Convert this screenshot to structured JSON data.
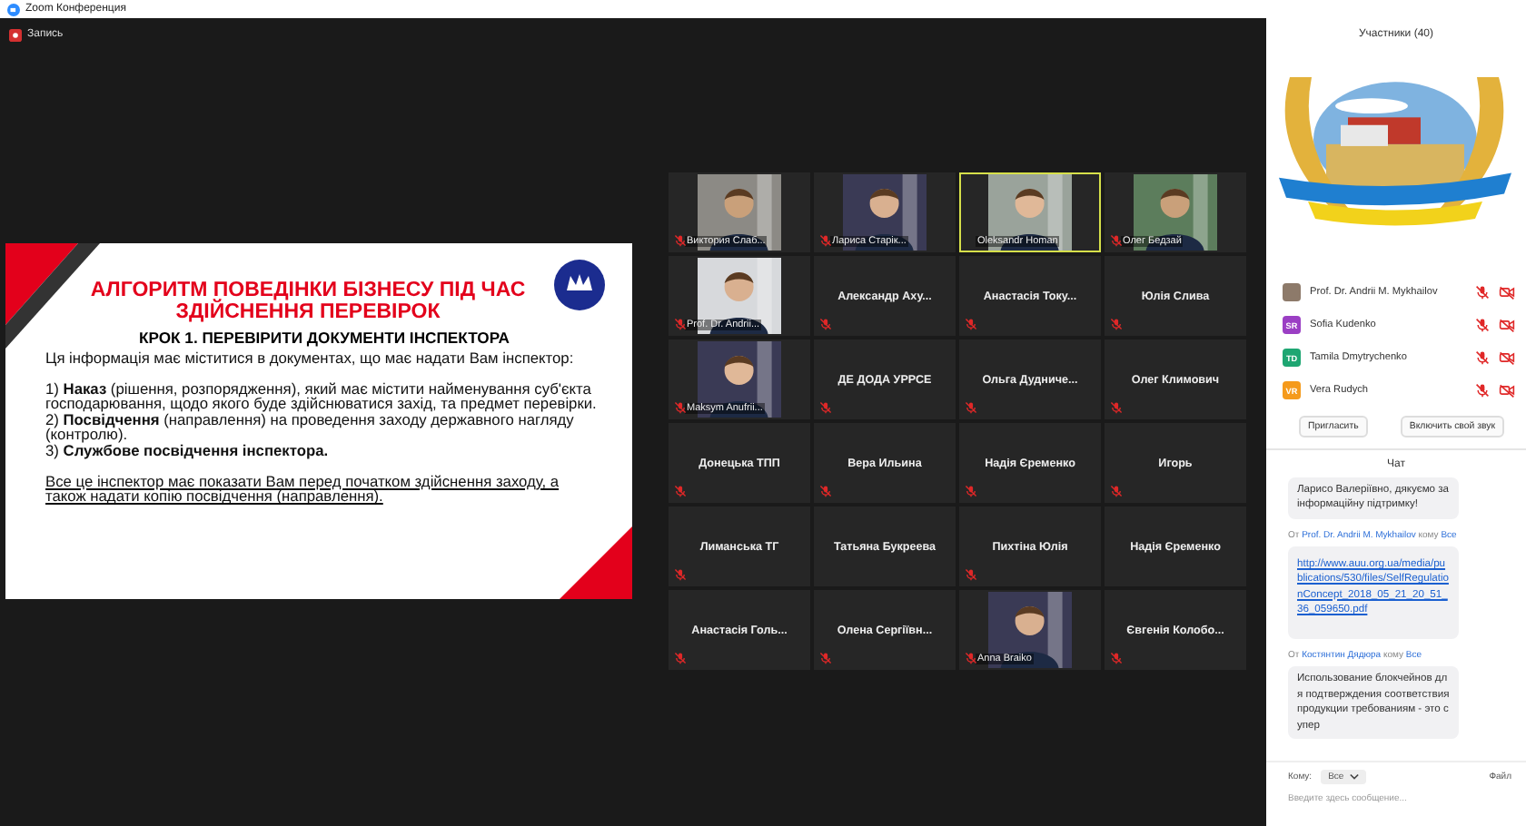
{
  "window": {
    "title": "Zoom Конференция"
  },
  "recording": {
    "label": "Запись"
  },
  "slide": {
    "title": "АЛГОРИТМ  ПОВЕДІНКИ БІЗНЕСУ ПІД ЧАС ЗДІЙСНЕННЯ ПЕРЕВІРОК",
    "subtitle": "КРОК 1. ПЕРЕВІРИТИ ДОКУМЕНТИ ІНСПЕКТОРА",
    "intro": "Ця інформація має міститися в документах, що має надати Вам інспектор:",
    "points": [
      "1) **Наказ** (рішення, розпорядження), який має містити найменування суб'єкта господарювання, щодо якого буде здійснюватися захід, та предмет перевірки.",
      "2) **Посвідчення** (направлення) на проведення заходу державного нагляду (контролю).",
      "3) **Службове посвідчення інспектора.**"
    ],
    "note": "Все це інспектор має показати Вам перед початком здійснення заходу, а також надати копію посвідчення (направлення)."
  },
  "tiles": [
    {
      "name": "Виктория Слаб...",
      "kind": "video",
      "muted": true,
      "speaking": false
    },
    {
      "name": "Лариса Старік...",
      "kind": "video",
      "muted": true,
      "speaking": false
    },
    {
      "name": "Oleksandr Homan",
      "kind": "video",
      "muted": false,
      "speaking": true
    },
    {
      "name": "Олег Бедзай",
      "kind": "video",
      "muted": true,
      "speaking": false
    },
    {
      "name": "Prof. Dr. Andrii...",
      "kind": "video",
      "muted": true,
      "speaking": false
    },
    {
      "name": "Александр  Аху...",
      "kind": "name",
      "muted": true,
      "speaking": false
    },
    {
      "name": "Анастасія  Току...",
      "kind": "name",
      "muted": true,
      "speaking": false
    },
    {
      "name": "Юлія Слива",
      "kind": "name",
      "muted": true,
      "speaking": false
    },
    {
      "name": "Maksym Anufrii...",
      "kind": "video",
      "muted": true,
      "speaking": false
    },
    {
      "name": "ДЕ ДОДА УРРСЕ",
      "kind": "name",
      "muted": true,
      "speaking": false
    },
    {
      "name": "Ольга  Дудниче...",
      "kind": "name",
      "muted": true,
      "speaking": false
    },
    {
      "name": "Олег Климович",
      "kind": "name",
      "muted": true,
      "speaking": false
    },
    {
      "name": "Донецька ТПП",
      "kind": "name",
      "muted": true,
      "speaking": false
    },
    {
      "name": "Вера Ильина",
      "kind": "name",
      "muted": true,
      "speaking": false
    },
    {
      "name": "Надія Єременко",
      "kind": "name",
      "muted": true,
      "speaking": false
    },
    {
      "name": "Игорь",
      "kind": "name",
      "muted": true,
      "speaking": false
    },
    {
      "name": "Лиманська ТГ",
      "kind": "name",
      "muted": true,
      "speaking": false
    },
    {
      "name": "Татьяна Букреева",
      "kind": "name",
      "muted": false,
      "speaking": false
    },
    {
      "name": "Пихтіна Юлія",
      "kind": "name",
      "muted": true,
      "speaking": false
    },
    {
      "name": "Надія Єременко",
      "kind": "name",
      "muted": false,
      "speaking": false
    },
    {
      "name": "Анастасія Голь...",
      "kind": "name",
      "muted": true,
      "speaking": false
    },
    {
      "name": "Олена  Сергіївн...",
      "kind": "name",
      "muted": true,
      "speaking": false
    },
    {
      "name": "Anna Braiko",
      "kind": "video",
      "muted": true,
      "speaking": false
    },
    {
      "name": "Євгенія  Колобо...",
      "kind": "name",
      "muted": true,
      "speaking": false
    }
  ],
  "participants": {
    "title": "Участники (40)",
    "items": [
      {
        "name": "Prof. Dr. Andrii M. Mykhailov",
        "muted": true,
        "camera_off": true
      },
      {
        "name": "Sofia Kudenko",
        "kind": "initials",
        "initials": "SR",
        "color": "#9b3fc4",
        "muted": true,
        "camera_off": true
      },
      {
        "name": "Tamila Dmytrychenko",
        "kind": "initials",
        "initials": "TD",
        "color": "#1ea672",
        "muted": true,
        "camera_off": true
      },
      {
        "name": "Vera Rudych",
        "kind": "initials",
        "initials": "VR",
        "color": "#f59a1b",
        "muted": true,
        "camera_off": true
      }
    ],
    "buttons": [
      "Пригласить",
      "Включить свой звук"
    ]
  },
  "chat": {
    "title": "Чат",
    "messages": [
      {
        "kind": "text",
        "text": "Ларисо Валеріївно, дякуємо за інформаційну підтримку!"
      },
      {
        "kind": "link",
        "from_prefix": "От",
        "from": "Prof. Dr. Andrii M. Mykhailov",
        "to_prefix": "кому",
        "to": "Все",
        "text": "http://www.auu.org.ua/media/publications/530/files/SelfRegulationConcept_2018_05_21_20_51_36_059650.pdf"
      },
      {
        "kind": "text",
        "from_prefix": "От",
        "from": "Костянтин Дядюра",
        "to_prefix": "кому",
        "to": "Все",
        "text": "Использование блокчейнов для  подтверждения соответствия продукции требованиям - это супер"
      }
    ],
    "to_label": "Кому:",
    "recipient": "Все",
    "file_label": "Файл",
    "placeholder": "Введите здесь сообщение..."
  }
}
